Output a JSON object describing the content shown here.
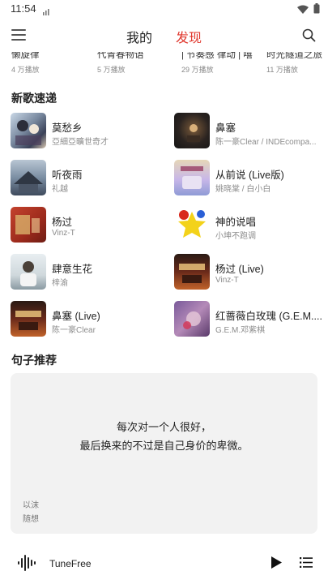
{
  "status": {
    "time": "11:54"
  },
  "header": {
    "tab_mine": "我的",
    "tab_discover": "发现"
  },
  "playlists": [
    {
      "title": "懒旋律",
      "count": "4 万播放"
    },
    {
      "title": "代青春物语",
      "count": "5 万播放"
    },
    {
      "title": "| 节奏感 律动 | 嘻",
      "count": "29 万播放"
    },
    {
      "title": "时光隧道之旅",
      "count": "11 万播放"
    }
  ],
  "new_songs": {
    "title": "新歌速递",
    "items": [
      {
        "name": "莫愁乡",
        "artist": "亞細亞曠世奇才"
      },
      {
        "name": "鼻塞",
        "artist": "陈一豪Clear / INDEcompa..."
      },
      {
        "name": "听夜雨",
        "artist": "礼越"
      },
      {
        "name": "从前说 (Live版)",
        "artist": "姚晓棠 / 白小白"
      },
      {
        "name": "杨过",
        "artist": "Vinz-T"
      },
      {
        "name": "神的说唱",
        "artist": "小坤不跑调"
      },
      {
        "name": "肆意生花",
        "artist": "梓渝"
      },
      {
        "name": "杨过 (Live)",
        "artist": "Vinz-T"
      },
      {
        "name": "鼻塞 (Live)",
        "artist": "陈一豪Clear"
      },
      {
        "name": "红蔷薇白玫瑰 (G.E.M....",
        "artist": "G.E.M.邓紫棋"
      }
    ]
  },
  "quote": {
    "title": "句子推荐",
    "line1": "每次对一个人很好，",
    "line2": "最后换来的不过是自己身价的卑微。",
    "author": "以沫",
    "source": "随想"
  },
  "player": {
    "title": "TuneFree"
  },
  "colors": {
    "accent": "#e0352b",
    "card_bg": "#f2f2f2"
  }
}
